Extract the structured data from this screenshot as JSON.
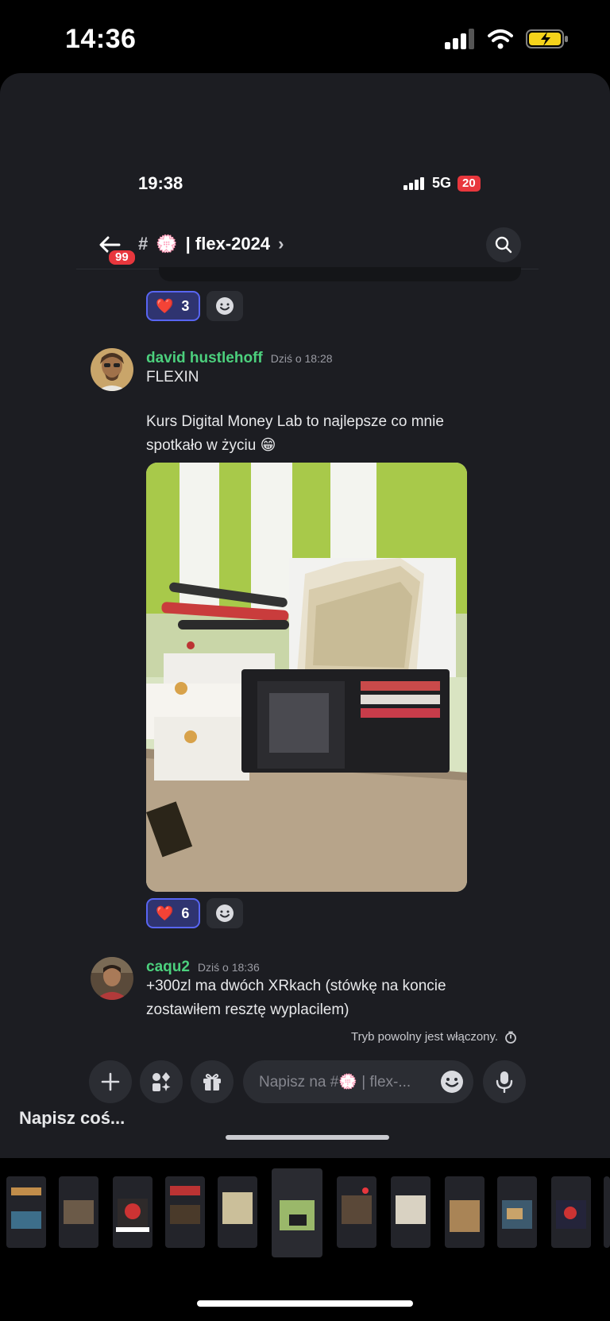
{
  "outer_status": {
    "time": "14:36"
  },
  "inner_status": {
    "time": "19:38",
    "network": "5G",
    "battery": "20"
  },
  "header": {
    "unread_badge": "99",
    "channel_hash": "#",
    "channel_emoji": "💮",
    "channel_name": "| flex-2024",
    "chevron": "›"
  },
  "prev_reaction": {
    "emoji": "❤️",
    "count": "3"
  },
  "messages": [
    {
      "username": "david hustlehoff",
      "timestamp": "Dziś o 18:28",
      "line1": "FLEXIN",
      "line2": "Kurs Digital Money Lab to najlepsze co mnie",
      "line3": "spotkało w życiu 😁",
      "reaction": {
        "emoji": "❤️",
        "count": "6"
      }
    },
    {
      "username": "caqu2",
      "timestamp": "Dziś o 18:36",
      "line1": "+300zl ma dwóch XRkach (stówkę na koncie",
      "line2": "zostawiłem resztę wyplacilem)"
    }
  ],
  "slowmode": {
    "text": "Tryb powolny jest włączony."
  },
  "composer": {
    "placeholder": "Napisz na #💮 | flex-...",
    "hint": "Napisz coś..."
  },
  "icons": [
    "signal-icon",
    "wifi-icon",
    "battery-charging-icon",
    "back-arrow-icon",
    "search-icon",
    "add-reaction-icon",
    "plus-icon",
    "apps-icon",
    "gift-icon",
    "emoji-icon",
    "microphone-icon",
    "timer-icon"
  ],
  "colors": {
    "username": "#4cd07d",
    "accent": "#5865f2",
    "badge": "#e8373d",
    "background": "#1c1d22"
  }
}
